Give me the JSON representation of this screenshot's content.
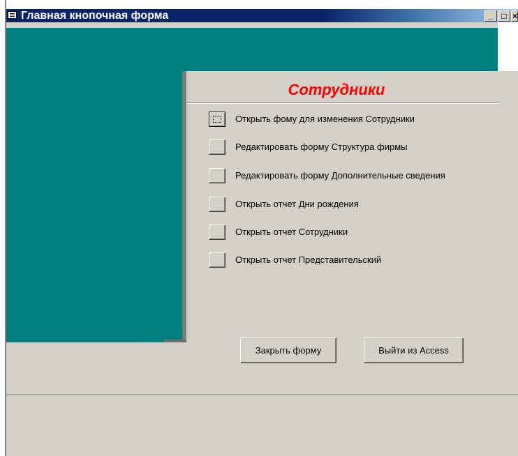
{
  "window": {
    "title": "Главная кнопочная форма",
    "icon": "form-icon",
    "controls": {
      "minimize": "_",
      "maximize": "□",
      "close": "×"
    }
  },
  "switchboard": {
    "title": "Сотрудники",
    "title_color": "#ff0000",
    "background_color": "#008080",
    "items": [
      {
        "label": "Открыть фому для изменения Сотрудники",
        "focused": true
      },
      {
        "label": "Редактировать форму Структура фирмы",
        "focused": false
      },
      {
        "label": "Редактировать форму Дополнительные сведения",
        "focused": false
      },
      {
        "label": "Открыть отчет Дни рождения",
        "focused": false
      },
      {
        "label": "Открыть отчет Сотрудники",
        "focused": false
      },
      {
        "label": "Открыть отчет Представительский",
        "focused": false
      }
    ],
    "close_button": "Закрыть форму",
    "exit_button": "Выйти из Access"
  }
}
